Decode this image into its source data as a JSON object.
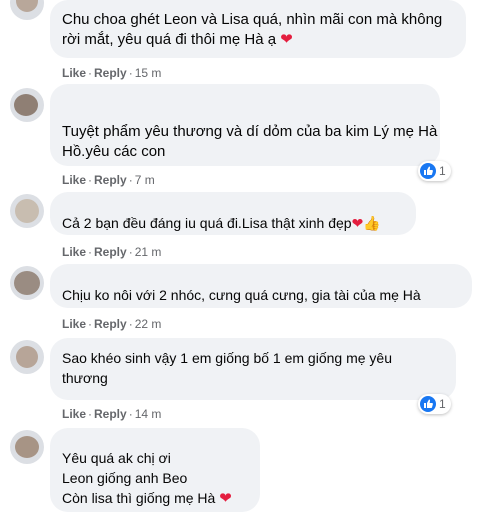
{
  "comments": [
    {
      "lines": [
        "Chu choa ghét Leon và Lisa quá, nhìn mãi con mà không",
        "rời mắt, yêu quá đi thôi mẹ Hà ạ"
      ],
      "emoji": "❤",
      "like": "Like",
      "reply": "Reply",
      "time": "15 m"
    },
    {
      "lines": [
        "Tuyệt phẩm yêu thương và dí dỏm của ba kim Lý mẹ Hà",
        "Hồ.yêu các con"
      ],
      "like": "Like",
      "reply": "Reply",
      "time": "7 m",
      "reaction_count": "1"
    },
    {
      "lines": [
        "Cả 2 bạn đều đáng iu quá đi.Lisa thật xinh đẹp"
      ],
      "emoji": "❤👍",
      "like": "Like",
      "reply": "Reply",
      "time": "21 m"
    },
    {
      "lines": [
        "Chịu ko nôi với 2 nhóc, cưng quá cưng, gia tài của mẹ Hà"
      ],
      "like": "Like",
      "reply": "Reply",
      "time": "22 m"
    },
    {
      "lines": [
        "Sao khéo sinh vậy 1 em giống bố 1 em giống mẹ yêu",
        "thương"
      ],
      "like": "Like",
      "reply": "Reply",
      "time": "14 m",
      "reaction_count": "1"
    },
    {
      "lines": [
        "Yêu quá ak chị ơi",
        "Leon giống anh Beo",
        "Còn lisa thì giống mẹ Hà"
      ],
      "emoji": "❤"
    }
  ],
  "separator": "·",
  "icons": {
    "like": "like-icon",
    "heart": "heart-icon",
    "thumbs_up": "thumbs-up-icon"
  },
  "colors": {
    "bubble": "#f0f2f5",
    "meta": "#65676b",
    "like_blue": "#1877f2",
    "heart": "#e41e3f"
  }
}
